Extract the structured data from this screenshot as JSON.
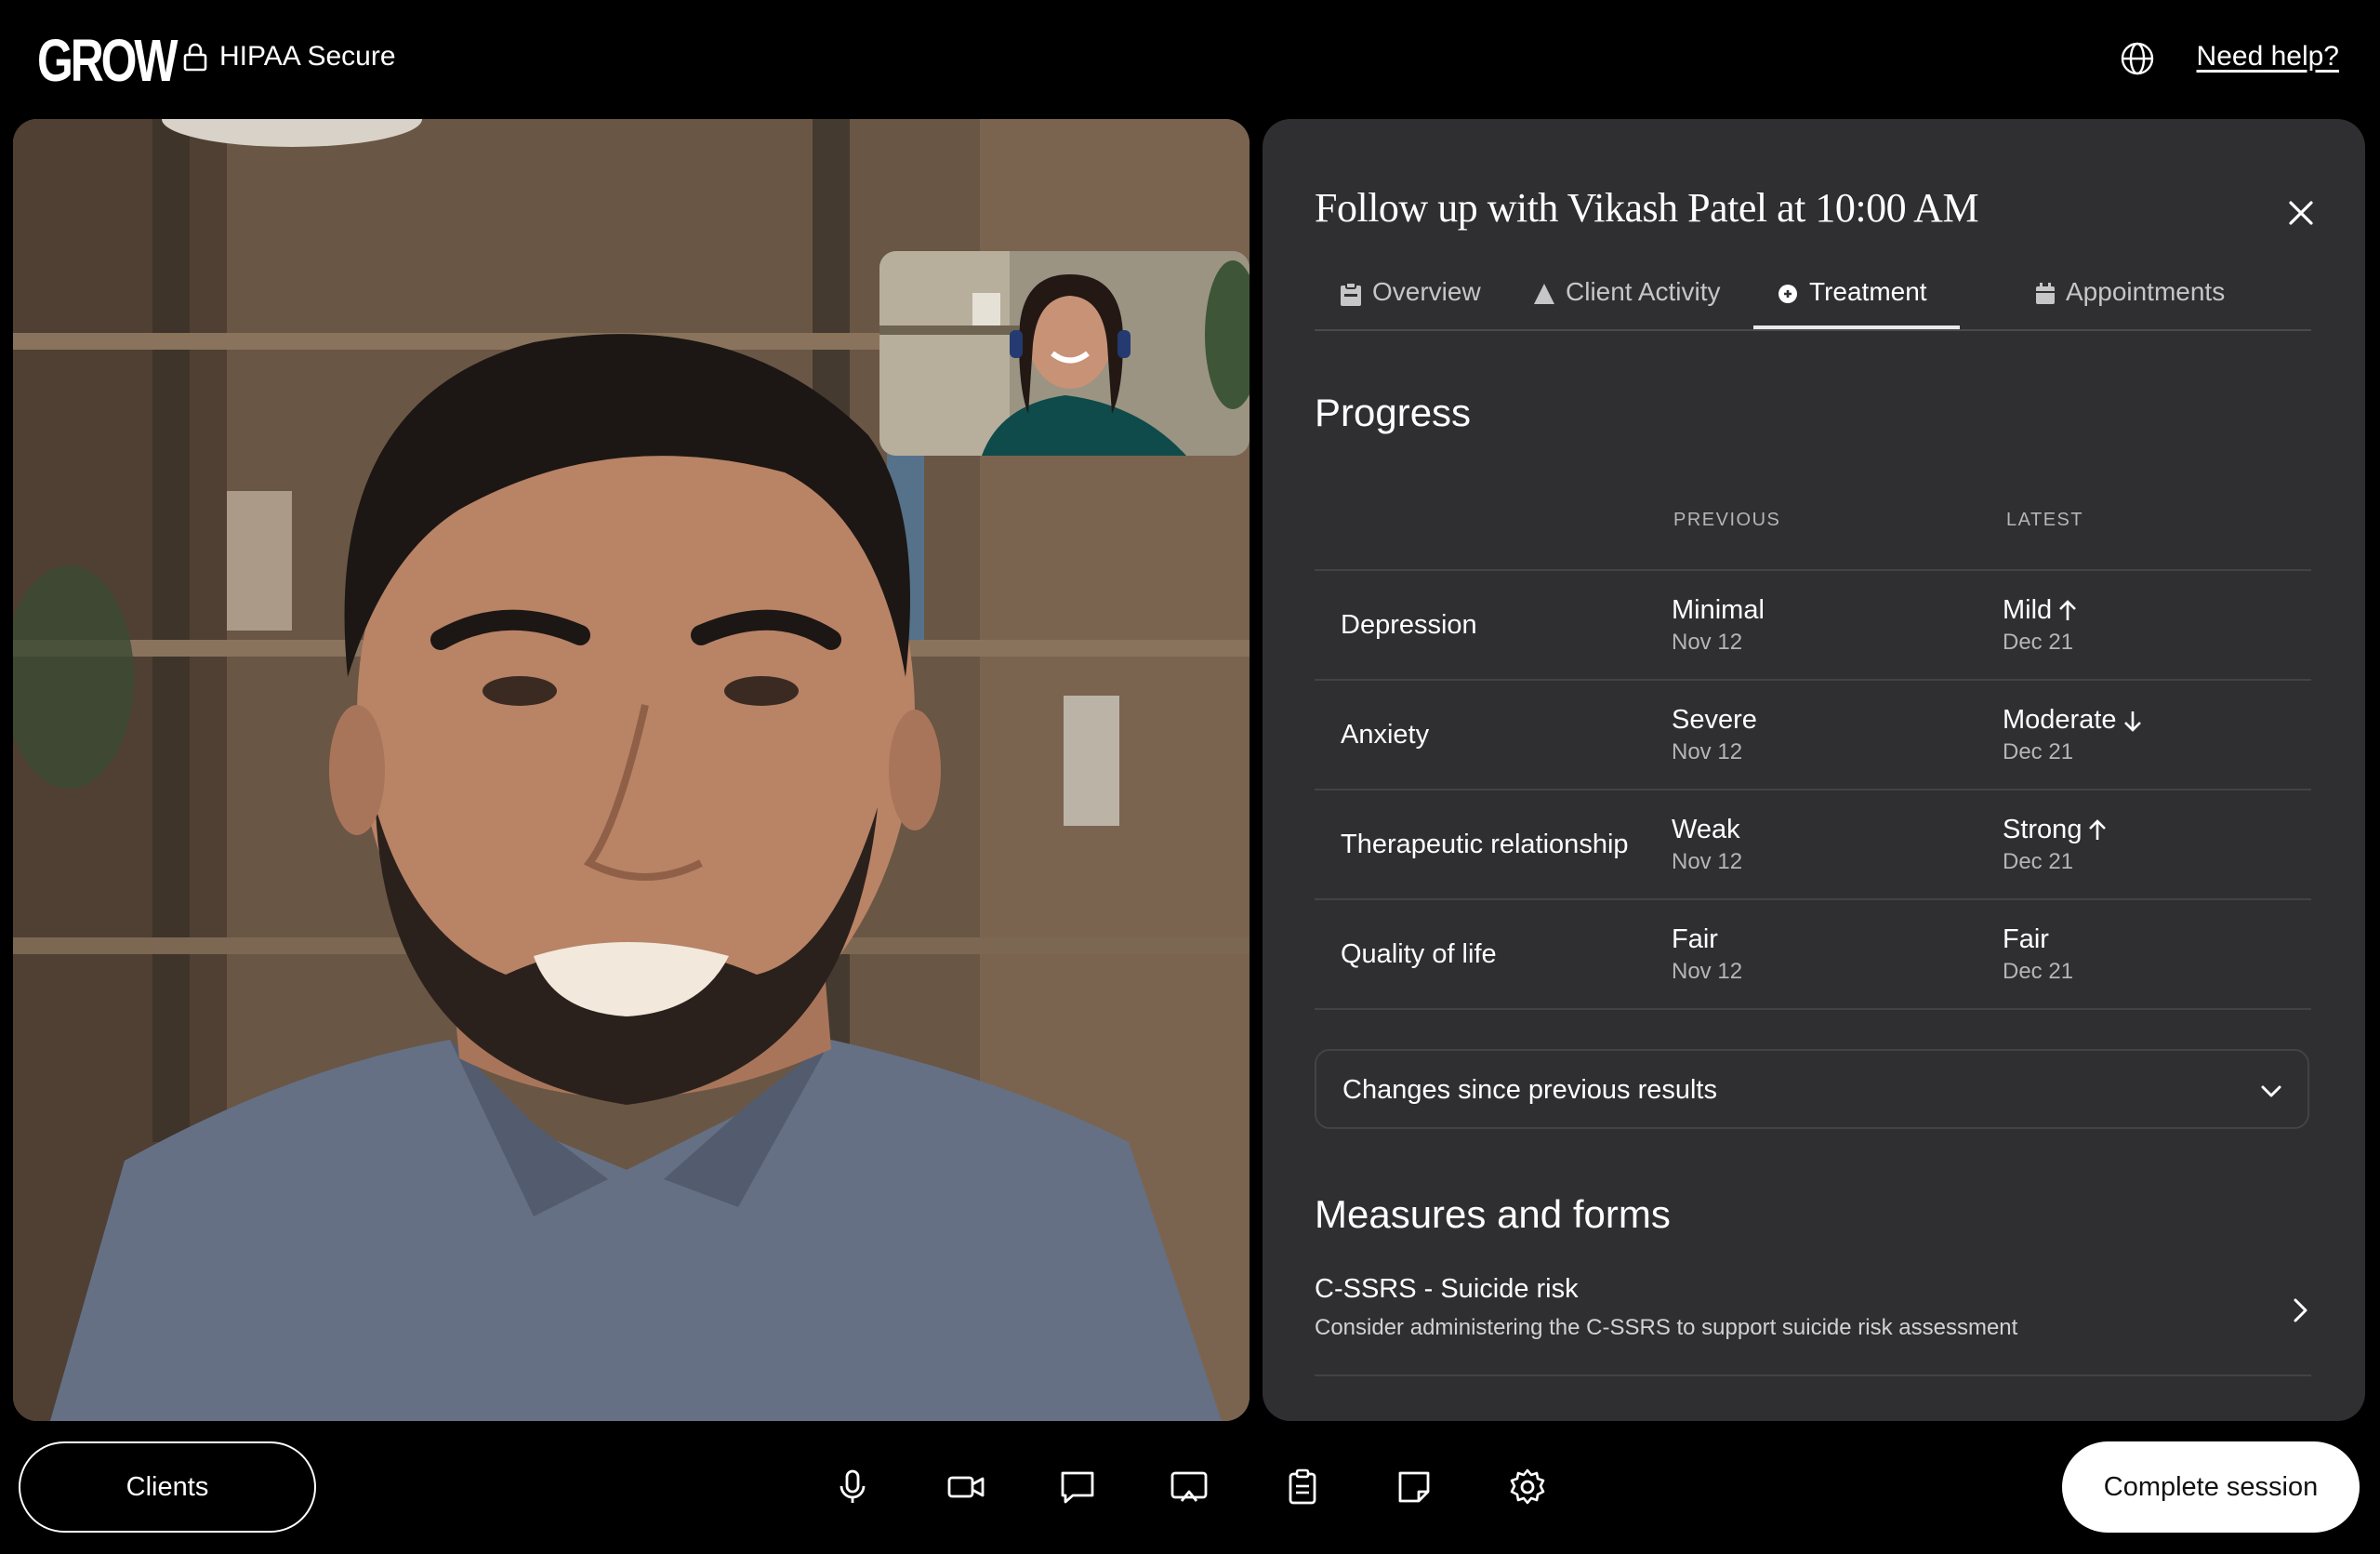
{
  "header": {
    "logo": "GROW",
    "security_label": "HIPAA Secure",
    "help_link": "Need help?"
  },
  "panel": {
    "title": "Follow up with Vikash Patel at 10:00 AM",
    "tabs": [
      {
        "label": "Overview",
        "icon": "clipboard-icon"
      },
      {
        "label": "Client Activity",
        "icon": "triangle-icon"
      },
      {
        "label": "Treatment",
        "icon": "bandage-icon",
        "active": true
      },
      {
        "label": "Appointments",
        "icon": "calendar-icon"
      }
    ],
    "progress": {
      "heading": "Progress",
      "columns": [
        "PREVIOUS",
        "LATEST"
      ],
      "rows": [
        {
          "label": "Depression",
          "prev": "Minimal",
          "prev_date": "Nov 12",
          "latest": "Mild",
          "latest_date": "Dec 21",
          "trend": "up"
        },
        {
          "label": "Anxiety",
          "prev": "Severe",
          "prev_date": "Nov 12",
          "latest": "Moderate",
          "latest_date": "Dec 21",
          "trend": "down"
        },
        {
          "label": "Therapeutic relationship",
          "prev": "Weak",
          "prev_date": "Nov 12",
          "latest": "Strong",
          "latest_date": "Dec 21",
          "trend": "up"
        },
        {
          "label": "Quality of life",
          "prev": "Fair",
          "prev_date": "Nov 12",
          "latest": "Fair",
          "latest_date": "Dec 21",
          "trend": "none"
        }
      ]
    },
    "changes_label": "Changes since previous results",
    "measures": {
      "heading": "Measures and forms",
      "items": [
        {
          "title": "C-SSRS - Suicide risk",
          "description": "Consider administering the C-SSRS to support suicide risk assessment"
        }
      ]
    }
  },
  "bottom": {
    "clients_label": "Clients",
    "complete_label": "Complete session",
    "controls": [
      "microphone-icon",
      "camera-icon",
      "chat-icon",
      "screen-share-icon",
      "clipboard-icon",
      "note-icon",
      "settings-icon"
    ]
  },
  "colors": {
    "panel_bg": "#2f2f31",
    "background": "#000000",
    "divider": "#434346"
  }
}
